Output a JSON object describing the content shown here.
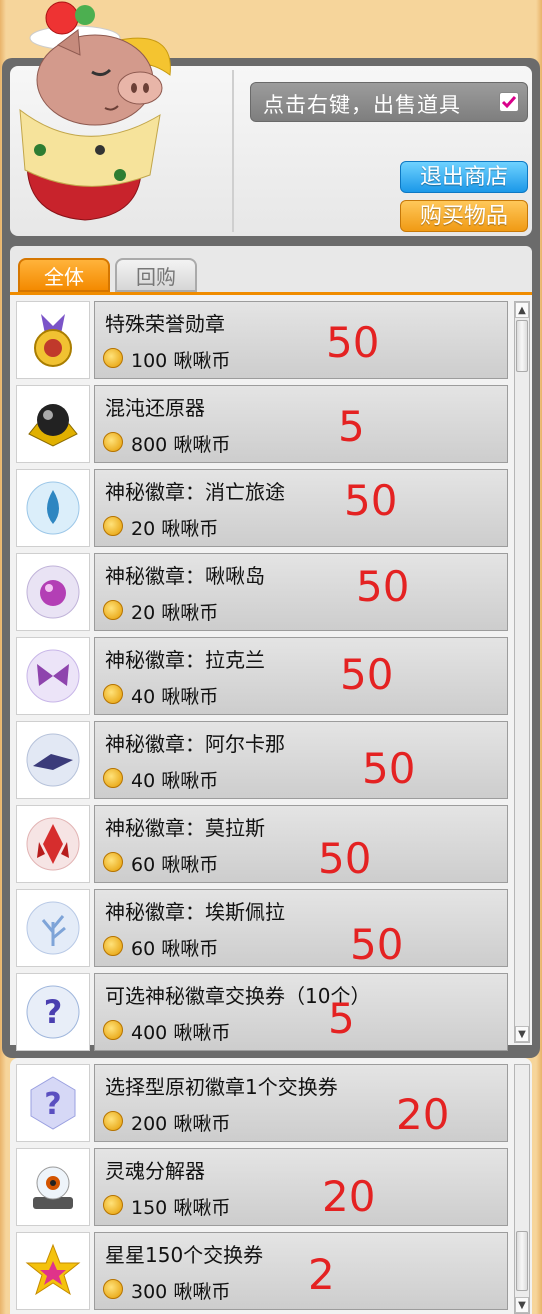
{
  "header": {
    "sell_hint": "点击右键，出售道具",
    "exit_button": "退出商店",
    "buy_button": "购买物品"
  },
  "tabs": [
    {
      "label": "全体",
      "active": true
    },
    {
      "label": "回购",
      "active": false
    }
  ],
  "items": [
    {
      "name": "特殊荣誉勋章",
      "price": "100",
      "currency": "啾啾币",
      "qty": "50",
      "icon": "medal-icon"
    },
    {
      "name": "混沌还原器",
      "price": "800",
      "currency": "啾啾币",
      "qty": "5",
      "icon": "chaos-restorer-icon"
    },
    {
      "name": "神秘徽章：消亡旅途",
      "price": "20",
      "currency": "啾啾币",
      "qty": "50",
      "icon": "water-badge-icon"
    },
    {
      "name": "神秘徽章：啾啾岛",
      "price": "20",
      "currency": "啾啾币",
      "qty": "50",
      "icon": "orb-badge-icon"
    },
    {
      "name": "神秘徽章：拉克兰",
      "price": "40",
      "currency": "啾啾币",
      "qty": "50",
      "icon": "butterfly-badge-icon"
    },
    {
      "name": "神秘徽章：阿尔卡那",
      "price": "40",
      "currency": "啾啾币",
      "qty": "50",
      "icon": "dragon-badge-icon"
    },
    {
      "name": "神秘徽章：莫拉斯",
      "price": "60",
      "currency": "啾啾币",
      "qty": "50",
      "icon": "crystal-badge-icon"
    },
    {
      "name": "神秘徽章：埃斯佩拉",
      "price": "60",
      "currency": "啾啾币",
      "qty": "50",
      "icon": "tree-badge-icon"
    },
    {
      "name": "可选神秘徽章交换券（10个）",
      "price": "400",
      "currency": "啾啾币",
      "qty": "5",
      "icon": "question-ticket-icon"
    },
    {
      "name": "选择型原初徽章1个交换券",
      "price": "200",
      "currency": "啾啾币",
      "qty": "20",
      "icon": "hex-question-icon"
    },
    {
      "name": "灵魂分解器",
      "price": "150",
      "currency": "啾啾币",
      "qty": "20",
      "icon": "soul-decomposer-icon"
    },
    {
      "name": "星星150个交换券",
      "price": "300",
      "currency": "啾啾币",
      "qty": "2",
      "icon": "star-ticket-icon"
    }
  ],
  "colors": {
    "accent_orange": "#f08c00",
    "exit_blue": "#1b98e8",
    "qty_red": "#e42222"
  }
}
